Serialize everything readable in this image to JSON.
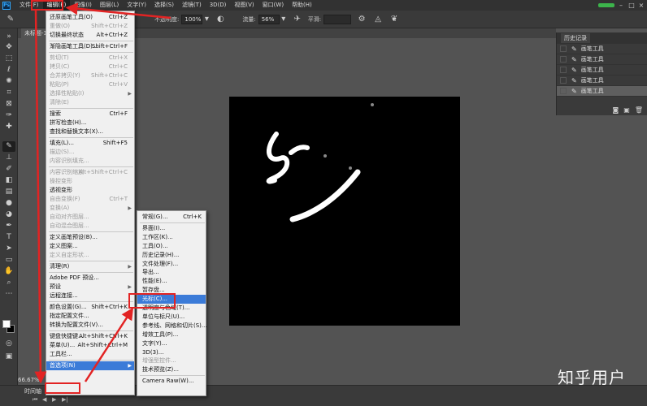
{
  "menubar": {
    "logo": "Ps",
    "items": [
      "文件(F)",
      "编辑(E)",
      "图像(I)",
      "图层(L)",
      "文字(Y)",
      "选择(S)",
      "滤镜(T)",
      "3D(D)",
      "视图(V)",
      "窗口(W)",
      "帮助(H)"
    ],
    "active_index": 1
  },
  "options": {
    "opacity_label": "不透明度:",
    "opacity_value": "100%",
    "flow_label": "流量:",
    "flow_value": "56%",
    "smooth_label": "平滑:"
  },
  "document": {
    "tab_label": "未标题-1",
    "zoom": "66.67%"
  },
  "edit_menu": [
    {
      "label": "还原画笔工具(O)",
      "shortcut": "Ctrl+Z",
      "disabled": false
    },
    {
      "label": "重做(O)",
      "shortcut": "Shift+Ctrl+Z",
      "disabled": true
    },
    {
      "label": "切换最终状态",
      "shortcut": "Alt+Ctrl+Z",
      "disabled": false
    },
    {
      "sep": true
    },
    {
      "label": "渐隐画笔工具(D)...",
      "shortcut": "Shift+Ctrl+F",
      "disabled": false
    },
    {
      "sep": true
    },
    {
      "label": "剪切(T)",
      "shortcut": "Ctrl+X",
      "disabled": true
    },
    {
      "label": "拷贝(C)",
      "shortcut": "Ctrl+C",
      "disabled": true
    },
    {
      "label": "合并拷贝(Y)",
      "shortcut": "Shift+Ctrl+C",
      "disabled": true
    },
    {
      "label": "粘贴(P)",
      "shortcut": "Ctrl+V",
      "disabled": true
    },
    {
      "label": "选择性粘贴(I)",
      "shortcut": "",
      "disabled": true,
      "submenu": true
    },
    {
      "label": "清除(E)",
      "shortcut": "",
      "disabled": true
    },
    {
      "sep": true
    },
    {
      "label": "搜索",
      "shortcut": "Ctrl+F",
      "disabled": false
    },
    {
      "label": "拼写检查(H)...",
      "shortcut": "",
      "disabled": false
    },
    {
      "label": "查找和替换文本(X)...",
      "shortcut": "",
      "disabled": false
    },
    {
      "sep": true
    },
    {
      "label": "填充(L)...",
      "shortcut": "Shift+F5",
      "disabled": false
    },
    {
      "label": "描边(S)...",
      "shortcut": "",
      "disabled": true
    },
    {
      "label": "内容识别填充...",
      "shortcut": "",
      "disabled": true
    },
    {
      "sep": true
    },
    {
      "label": "内容识别缩放",
      "shortcut": "Alt+Shift+Ctrl+C",
      "disabled": true
    },
    {
      "label": "操控变形",
      "shortcut": "",
      "disabled": true
    },
    {
      "label": "透视变形",
      "shortcut": "",
      "disabled": false
    },
    {
      "label": "自由变换(F)",
      "shortcut": "Ctrl+T",
      "disabled": true
    },
    {
      "label": "变换(A)",
      "shortcut": "",
      "disabled": true,
      "submenu": true
    },
    {
      "label": "自动对齐图层...",
      "shortcut": "",
      "disabled": true
    },
    {
      "label": "自动混合图层...",
      "shortcut": "",
      "disabled": true
    },
    {
      "sep": true
    },
    {
      "label": "定义画笔预设(B)...",
      "shortcut": "",
      "disabled": false
    },
    {
      "label": "定义图案...",
      "shortcut": "",
      "disabled": false
    },
    {
      "label": "定义自定形状...",
      "shortcut": "",
      "disabled": true
    },
    {
      "sep": true
    },
    {
      "label": "清理(R)",
      "shortcut": "",
      "disabled": false,
      "submenu": true
    },
    {
      "sep": true
    },
    {
      "label": "Adobe PDF 预设...",
      "shortcut": "",
      "disabled": false
    },
    {
      "label": "预设",
      "shortcut": "",
      "disabled": false,
      "submenu": true
    },
    {
      "label": "远程连接...",
      "shortcut": "",
      "disabled": false
    },
    {
      "sep": true
    },
    {
      "label": "颜色设置(G)...",
      "shortcut": "Shift+Ctrl+K",
      "disabled": false
    },
    {
      "label": "指定配置文件...",
      "shortcut": "",
      "disabled": false
    },
    {
      "label": "转换为配置文件(V)...",
      "shortcut": "",
      "disabled": false
    },
    {
      "sep": true
    },
    {
      "label": "键盘快捷键...",
      "shortcut": "Alt+Shift+Ctrl+K",
      "disabled": false
    },
    {
      "label": "菜单(U)...",
      "shortcut": "Alt+Shift+Ctrl+M",
      "disabled": false
    },
    {
      "label": "工具栏...",
      "shortcut": "",
      "disabled": false
    },
    {
      "sep": true
    },
    {
      "label": "首选项(N)",
      "shortcut": "",
      "disabled": false,
      "submenu": true,
      "highlight": true
    }
  ],
  "prefs_menu": [
    {
      "label": "常规(G)...",
      "shortcut": "Ctrl+K"
    },
    {
      "sep": true
    },
    {
      "label": "界面(I)..."
    },
    {
      "label": "工作区(K)..."
    },
    {
      "label": "工具(O)..."
    },
    {
      "label": "历史记录(H)..."
    },
    {
      "label": "文件处理(F)..."
    },
    {
      "label": "导出..."
    },
    {
      "label": "性能(E)..."
    },
    {
      "label": "暂存盘..."
    },
    {
      "label": "光标(C)...",
      "highlight": true
    },
    {
      "label": "透明度与色域(T)..."
    },
    {
      "label": "单位与标尺(U)..."
    },
    {
      "label": "参考线、网格和切片(S)..."
    },
    {
      "label": "增效工具(P)..."
    },
    {
      "label": "文字(Y)..."
    },
    {
      "label": "3D(3)..."
    },
    {
      "label": "增强型控件...",
      "disabled": true
    },
    {
      "label": "技术预览(Z)..."
    },
    {
      "sep": true
    },
    {
      "label": "Camera Raw(W)..."
    }
  ],
  "history": {
    "tab": "历史记录",
    "items": [
      "画笔工具",
      "画笔工具",
      "画笔工具",
      "画笔工具",
      "画笔工具"
    ],
    "selected_index": 4
  },
  "timeline": {
    "label": "时间轴"
  },
  "watermark": "知乎用户",
  "colors": {
    "highlight": "#3b7bd8",
    "annotation": "#e22323"
  }
}
